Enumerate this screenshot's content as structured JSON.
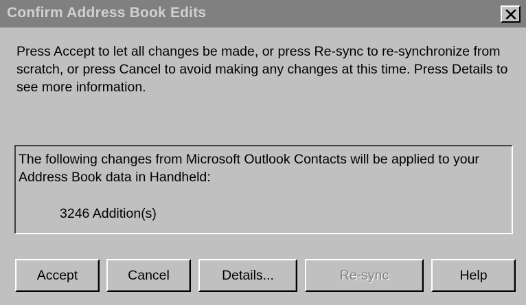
{
  "window": {
    "title": "Confirm Address Book Edits",
    "close_glyph": "✕"
  },
  "message": "Press Accept to let all changes be made, or press Re-sync to re-synchronize from scratch, or press Cancel to avoid making any changes at this time. Press Details to see more information.",
  "details_box": {
    "text": "The following changes from Microsoft Outlook Contacts will be applied to your Address Book data in Handheld:",
    "count": "3246 Addition(s)"
  },
  "buttons": {
    "accept": "Accept",
    "cancel": "Cancel",
    "details": "Details...",
    "resync": "Re-sync",
    "help": "Help"
  },
  "colors": {
    "face": "#c0c0c0",
    "titlebar": "#808080",
    "title_text": "#d0d0d0",
    "disabled_text": "#808080"
  },
  "icons": {
    "close": "close-icon"
  }
}
